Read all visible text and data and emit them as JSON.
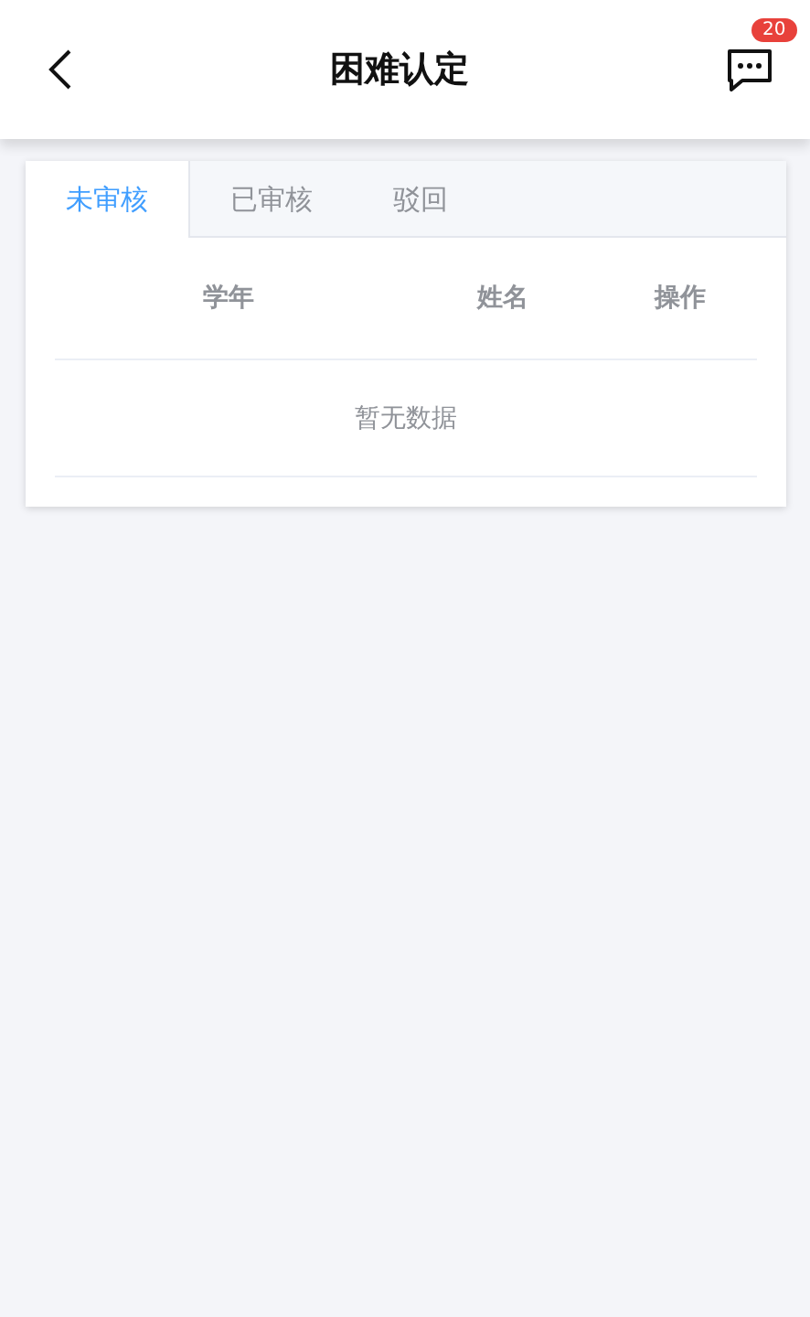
{
  "header": {
    "title": "困难认定",
    "badge": "20"
  },
  "tabs": [
    {
      "label": "未审核",
      "selected": true
    },
    {
      "label": "已审核",
      "selected": false
    },
    {
      "label": "驳回",
      "selected": false
    }
  ],
  "table": {
    "columns": [
      "学年",
      "姓名",
      "操作"
    ],
    "empty_text": "暂无数据"
  }
}
